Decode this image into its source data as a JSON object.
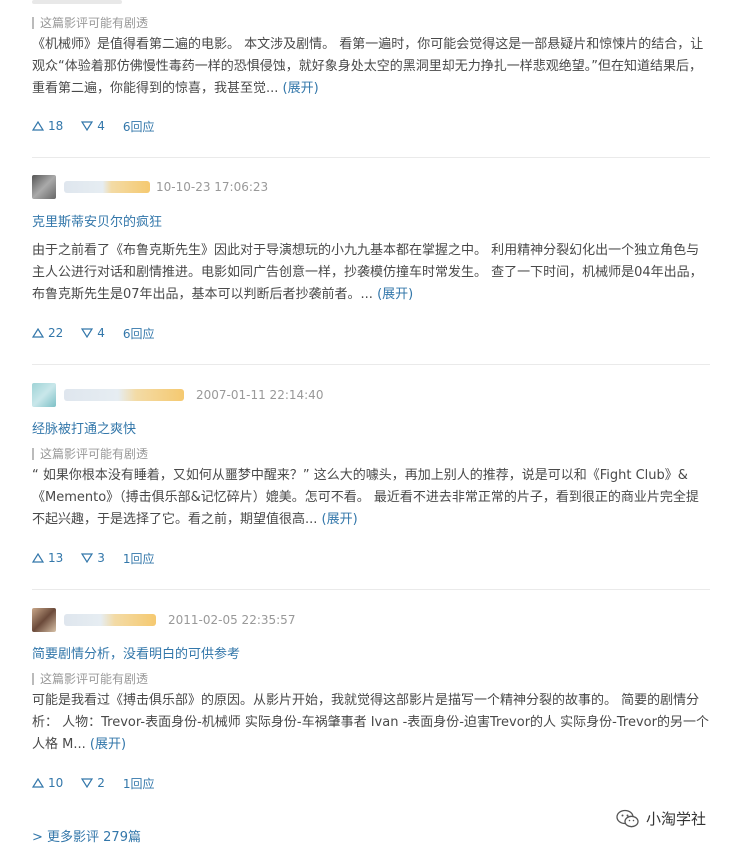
{
  "reviews": [
    {
      "spoiler": "这篇影评可能有剧透",
      "body": "《机械师》是值得看第二遍的电影。 本文涉及剧情。 看第一遍时，你可能会觉得这是一部悬疑片和惊悚片的结合，让观众“体验着那仿佛慢性毒药一样的恐惧侵蚀，就好象身处太空的黑洞里却无力挣扎一样悲观绝望。”但在知道结果后，重看第二遍，你能得到的惊喜，我甚至觉...",
      "expand": "(展开)",
      "up": "18",
      "down": "4",
      "replies": "6回应"
    },
    {
      "date": "10-10-23 17:06:23",
      "title": "克里斯蒂安贝尔的疯狂",
      "body": "由于之前看了《布鲁克斯先生》因此对于导演想玩的小九九基本都在掌握之中。 利用精神分裂幻化出一个独立角色与主人公进行对话和剧情推进。电影如同广告创意一样，抄袭模仿撞车时常发生。 查了一下时间，机械师是04年出品，布鲁克斯先生是07年出品，基本可以判断后者抄袭前者。...",
      "expand": "(展开)",
      "up": "22",
      "down": "4",
      "replies": "6回应"
    },
    {
      "date": "2007-01-11 22:14:40",
      "title": "经脉被打通之爽快",
      "spoiler": "这篇影评可能有剧透",
      "body": "“ 如果你根本没有睡着，又如何从噩梦中醒来？” 这么大的噱头，再加上别人的推荐，说是可以和《Fight Club》&《Memento》（搏击俱乐部&记忆碎片）媲美。怎可不看。 最近看不进去非常正常的片子，看到很正的商业片完全提不起兴趣，于是选择了它。看之前，期望值很高...",
      "expand": "(展开)",
      "up": "13",
      "down": "3",
      "replies": "1回应"
    },
    {
      "date": "2011-02-05 22:35:57",
      "title": "简要剧情分析，没看明白的可供参考",
      "spoiler": "这篇影评可能有剧透",
      "body": "可能是我看过《搏击俱乐部》的原因。从影片开始，我就觉得这部影片是描写一个精神分裂的故事的。 简要的剧情分析： 人物：Trevor-表面身份-机械师 实际身份-车祸肇事者 Ivan -表面身份-迫害Trevor的人 实际身份-Trevor的另一个人格 M...",
      "expand": "(展开)",
      "up": "10",
      "down": "2",
      "replies": "1回应"
    }
  ],
  "more_link": "> 更多影评 279篇",
  "watermark": "小淘学社",
  "icons": {
    "up": "thumb-up-triangle",
    "down": "thumb-down-triangle",
    "wechat": "wechat-logo"
  },
  "colors": {
    "link": "#3377aa",
    "text": "#494949",
    "muted": "#999999"
  }
}
